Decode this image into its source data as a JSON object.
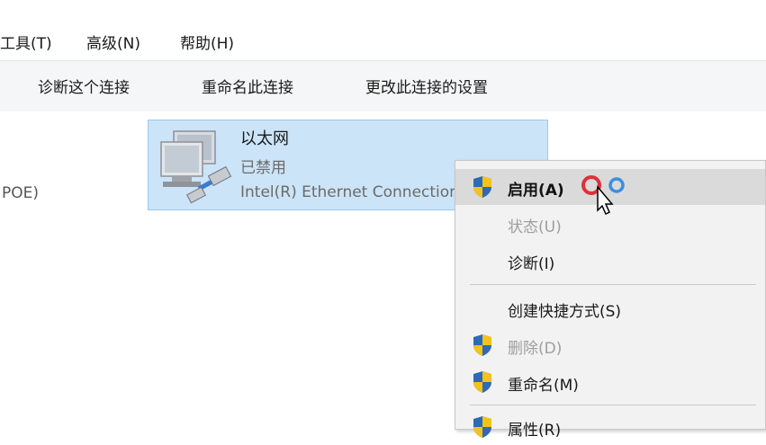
{
  "menubar": {
    "items": [
      {
        "label": "工具(T)"
      },
      {
        "label": "高级(N)"
      },
      {
        "label": "帮助(H)"
      }
    ]
  },
  "toolbar": {
    "buttons": [
      {
        "label": "诊断这个连接"
      },
      {
        "label": "重命名此连接"
      },
      {
        "label": "更改此连接的设置"
      }
    ]
  },
  "left_partial_text": "POE)",
  "adapter": {
    "name": "以太网",
    "status": "已禁用",
    "device": "Intel(R) Ethernet Connection"
  },
  "context_menu": {
    "items": [
      {
        "label": "启用(A)",
        "shield": true,
        "bold": true,
        "disabled": false,
        "highlighted": true
      },
      {
        "label": "状态(U)",
        "shield": false,
        "bold": false,
        "disabled": true
      },
      {
        "label": "诊断(I)",
        "shield": false,
        "bold": false,
        "disabled": false
      },
      {
        "label": "创建快捷方式(S)",
        "shield": false,
        "bold": false,
        "disabled": false
      },
      {
        "label": "删除(D)",
        "shield": true,
        "bold": false,
        "disabled": true
      },
      {
        "label": "重命名(M)",
        "shield": true,
        "bold": false,
        "disabled": false
      },
      {
        "label": "属性(R)",
        "shield": true,
        "bold": false,
        "disabled": false
      }
    ]
  },
  "colors": {
    "selection_bg": "#cce4f7",
    "selection_border": "#99c9ef",
    "menu_bg": "#f2f2f2",
    "menu_highlight": "#dadada",
    "shield_blue": "#2d6ab8",
    "shield_yellow": "#f4c21a"
  }
}
